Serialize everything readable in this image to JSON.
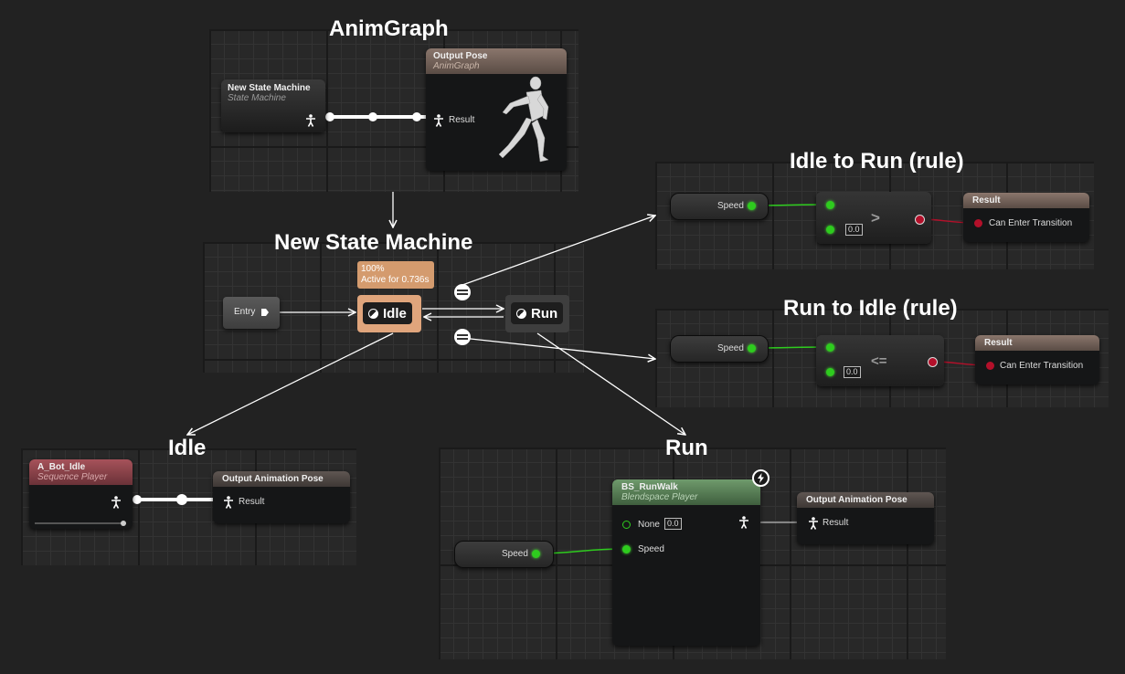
{
  "headings": {
    "anim_graph": "AnimGraph",
    "state_machine": "New State Machine",
    "idle_to_run": "Idle to Run (rule)",
    "run_to_idle": "Run to Idle (rule)",
    "idle": "Idle",
    "run": "Run"
  },
  "anim_graph": {
    "state_machine_node": {
      "title": "New State Machine",
      "subtitle": "State Machine"
    },
    "output_pose": {
      "title": "Output Pose",
      "subtitle": "AnimGraph",
      "pin": "Result"
    }
  },
  "state_machine": {
    "entry": "Entry",
    "tooltip_line1": "100%",
    "tooltip_line2": "Active for 0.736s",
    "idle_state": "Idle",
    "run_state": "Run"
  },
  "idle_to_run": {
    "speed_var": "Speed",
    "compare_value": "0.0",
    "operator": ">",
    "result_title": "Result",
    "result_pin": "Can Enter Transition"
  },
  "run_to_idle": {
    "speed_var": "Speed",
    "compare_value": "0.0",
    "operator": "<=",
    "result_title": "Result",
    "result_pin": "Can Enter Transition"
  },
  "idle_graph": {
    "sequence_player": {
      "title": "A_Bot_Idle",
      "subtitle": "Sequence Player"
    },
    "output": {
      "title": "Output Animation Pose",
      "pin": "Result"
    }
  },
  "run_graph": {
    "speed_var": "Speed",
    "blendspace": {
      "title": "BS_RunWalk",
      "subtitle": "Blendspace Player",
      "pin_none": "None",
      "none_value": "0.0",
      "pin_speed": "Speed"
    },
    "output": {
      "title": "Output Animation Pose",
      "pin": "Result"
    }
  },
  "colors": {
    "background": "#222222",
    "exec_wire": "#ffffff",
    "bool_wire": "#b3102a",
    "float_wire": "#2ecc1e",
    "state_active": "#e0a57c",
    "result_header": "#7d6b62",
    "sequence_header": "#a6525a",
    "blendspace_header": "#5a8a5a"
  }
}
